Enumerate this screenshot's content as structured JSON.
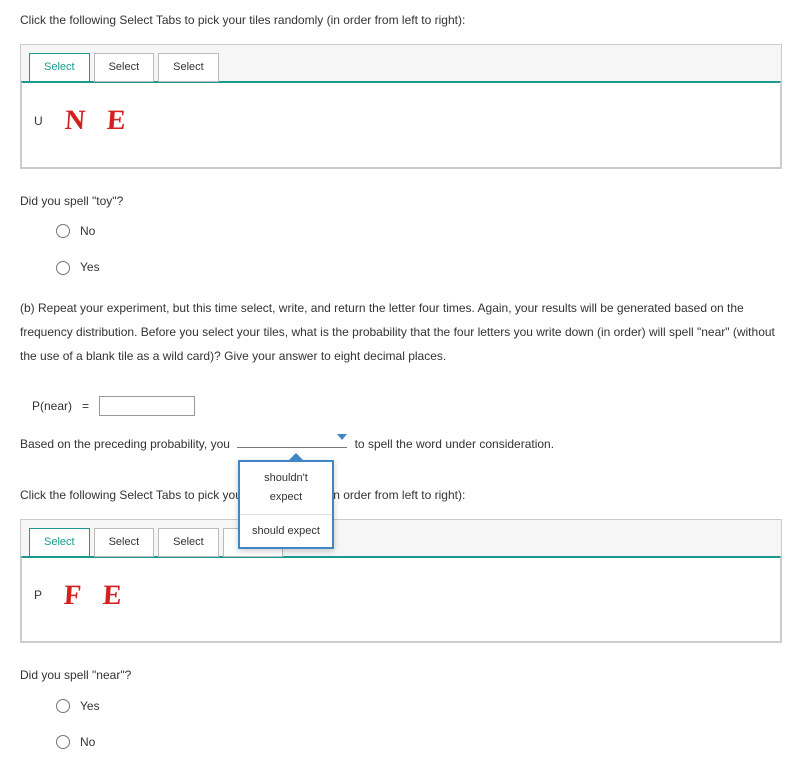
{
  "section1": {
    "instruction": "Click the following Select Tabs to pick your tiles randomly (in order from left to right):",
    "tabs": [
      "Select",
      "Select",
      "Select"
    ],
    "tiles": [
      "U",
      "N",
      "E"
    ],
    "question": "Did you spell \"toy\"?",
    "radios": [
      "No",
      "Yes"
    ]
  },
  "partB": {
    "text": "(b) Repeat your experiment, but this time select, write, and return the letter four times. Again, your results will be generated based on the frequency distribution. Before you select your tiles, what is the probability that the four letters you write down (in order) will spell \"near\" (without the use of a blank tile as a wild card)? Give your answer to eight decimal places.",
    "prob_label": "P(near)",
    "equals": "=",
    "prob_value": "",
    "sentence_pre": "Based on the preceding probability, you ",
    "sentence_post": " to spell the word under consideration.",
    "dropdown_options": [
      "shouldn't expect",
      "should expect"
    ]
  },
  "section2": {
    "instruction": "Click the following Select Tabs to pick your tiles randomly (in order from left to right):",
    "tabs": [
      "Select",
      "Select",
      "Select",
      "Select"
    ],
    "tiles": [
      "P",
      "F",
      "E"
    ],
    "question": "Did you spell \"near\"?",
    "radios": [
      "Yes",
      "No"
    ]
  }
}
